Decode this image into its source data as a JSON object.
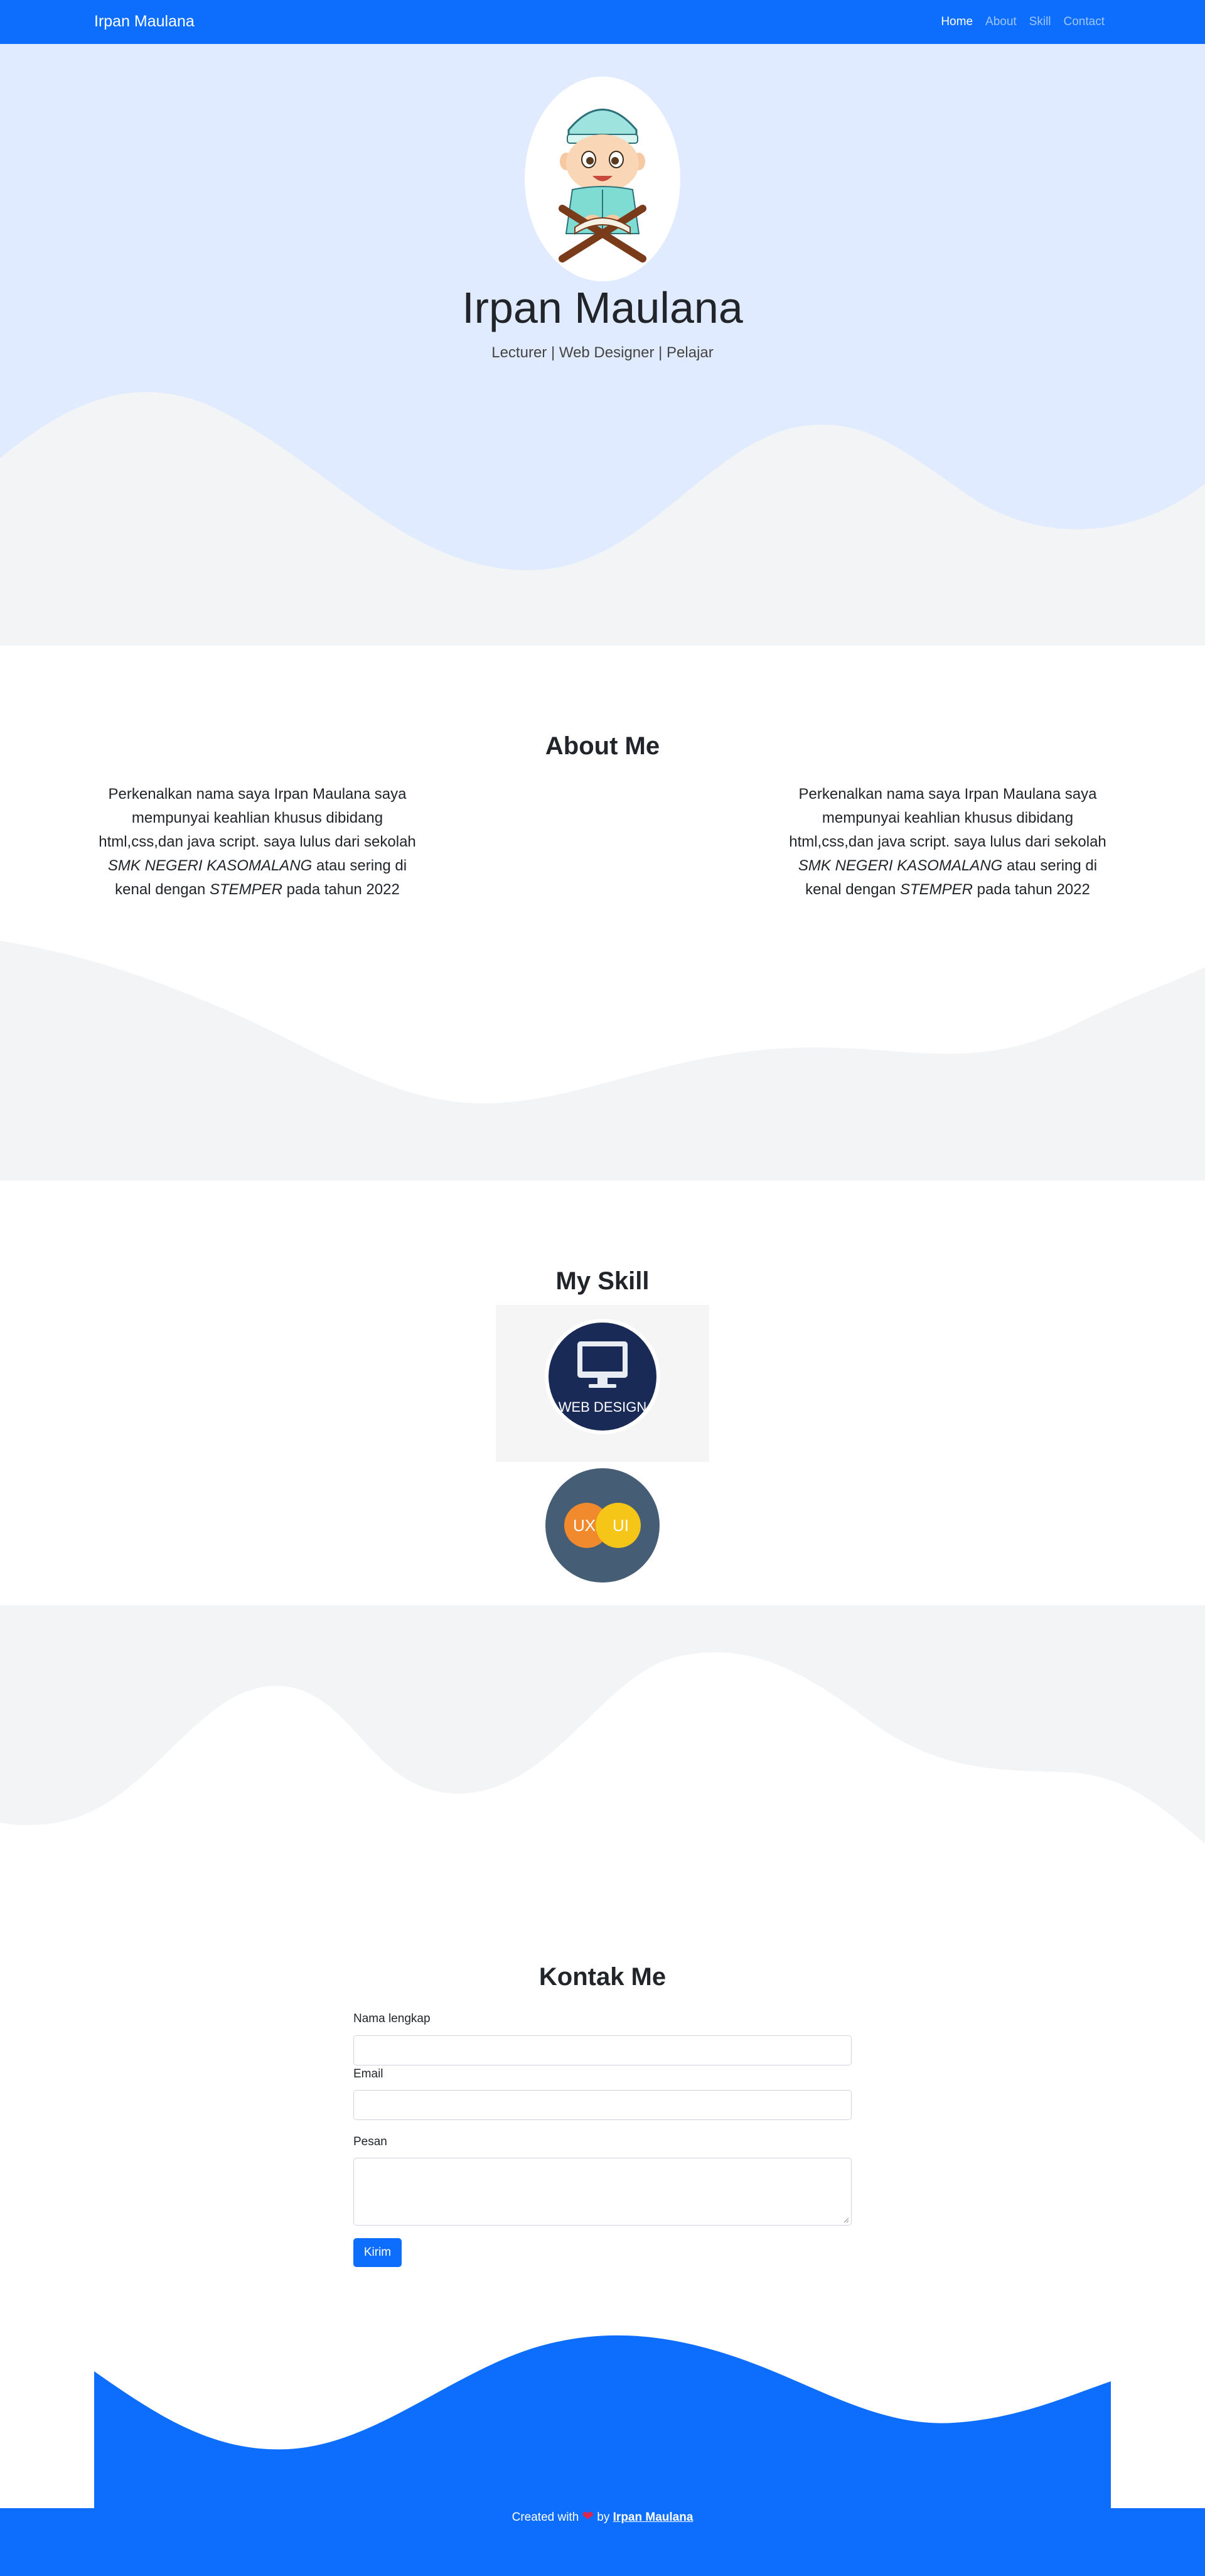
{
  "navbar": {
    "brand": "Irpan Maulana",
    "links": [
      {
        "label": "Home",
        "active": true
      },
      {
        "label": "About",
        "active": false
      },
      {
        "label": "Skill",
        "active": false
      },
      {
        "label": "Contact",
        "active": false
      }
    ]
  },
  "hero": {
    "name": "Irpan Maulana",
    "subtitle": "Lecturer | Web Designer | Pelajar"
  },
  "about": {
    "title": "About Me",
    "columns": [
      {
        "line1": "Perkenalkan nama saya Irpan Maulana saya",
        "line2": "mempunyai keahlian khusus dibidang",
        "line3": "html,css,dan java script. saya lulus dari sekolah",
        "school": "SMK NEGERI KASOMALANG",
        "line4_after": " atau sering di",
        "line5_before": "kenal dengan ",
        "nickname": "STEMPER",
        "line5_after": " pada tahun 2022"
      },
      {
        "line1": "Perkenalkan nama saya Irpan Maulana saya",
        "line2": "mempunyai keahlian khusus dibidang",
        "line3": "html,css,dan java script. saya lulus dari sekolah",
        "school": "SMK NEGERI KASOMALANG",
        "line4_after": " atau sering di",
        "line5_before": "kenal dengan ",
        "nickname": "STEMPER",
        "line5_after": " pada tahun 2022"
      }
    ]
  },
  "skill": {
    "title": "My Skill",
    "items": [
      {
        "label": "WEB DESIGN",
        "icon": "monitor-icon"
      },
      {
        "label_left": "UX",
        "label_right": "UI",
        "icon": "ux-ui-icon"
      }
    ]
  },
  "contact": {
    "title": "Kontak Me",
    "name_label": "Nama lengkap",
    "email_label": "Email",
    "message_label": "Pesan",
    "submit_label": "Kirim"
  },
  "footer": {
    "created_with": "Created with",
    "by": "by",
    "author": "Irpan Maulana"
  },
  "colors": {
    "primary": "#0d6efd",
    "hero_light": "#e0ebff",
    "wave_gray": "#f3f4f5",
    "heart": "#e0254a"
  }
}
